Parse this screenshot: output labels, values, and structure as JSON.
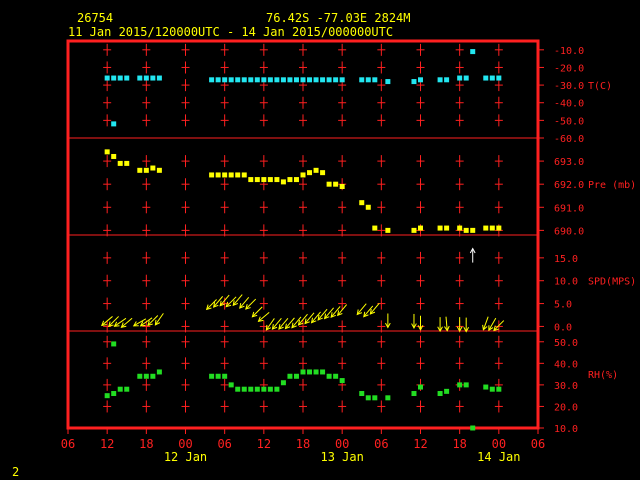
{
  "header": {
    "station_id": "26754",
    "location": "76.42S   -77.03E   2824M",
    "time_range": "11 Jan 2015/120000UTC - 14 Jan 2015/000000UTC"
  },
  "footer": {
    "page_number": "2"
  },
  "colors": {
    "frame": "#ff2020",
    "temperature": "#22e6f0",
    "pressure": "#ffff00",
    "wind": "#ffff00",
    "wind_outlier": "#ffffff",
    "humidity": "#22dd22",
    "header_text": "#ffff00"
  },
  "chart_data": [
    {
      "type": "scatter",
      "ylabel": "T(C)",
      "ylim": [
        -60,
        -5
      ],
      "yticks": [
        "-10.0",
        "-20.0",
        "-30.0",
        "-40.0",
        "-50.0",
        "-60.0"
      ],
      "ytick_values": [
        -10,
        -20,
        -30,
        -40,
        -50,
        -60
      ],
      "series": [
        {
          "x": [
            12,
            13,
            14,
            15,
            17,
            18,
            19,
            20,
            28,
            29,
            30,
            31,
            32,
            33,
            34,
            35,
            36,
            37,
            38,
            39,
            40,
            41,
            42,
            43,
            44,
            45,
            46,
            47,
            48,
            51,
            52,
            53,
            55,
            59,
            60,
            63,
            64,
            66,
            67,
            68,
            70,
            71,
            72
          ],
          "values": [
            -26,
            -26,
            -26,
            -26,
            -26,
            -26,
            -26,
            -26,
            -27,
            -27,
            -27,
            -27,
            -27,
            -27,
            -27,
            -27,
            -27,
            -27,
            -27,
            -27,
            -27,
            -27,
            -27,
            -27,
            -27,
            -27,
            -27,
            -27,
            -27,
            -27,
            -27,
            -27,
            -28,
            -28,
            -27,
            -27,
            -27,
            -26,
            -26,
            -11,
            -26,
            -26,
            -26
          ]
        },
        {
          "x": [
            13
          ],
          "values": [
            -52
          ]
        }
      ]
    },
    {
      "type": "scatter",
      "ylabel": "Pre (mb)",
      "ylim": [
        689.8,
        694.0
      ],
      "yticks": [
        "693.0",
        "692.0",
        "691.0",
        "690.0"
      ],
      "ytick_values": [
        693,
        692,
        691,
        690
      ],
      "series": [
        {
          "x": [
            12,
            13,
            14,
            15,
            17,
            18,
            19,
            20,
            28,
            29,
            30,
            31,
            32,
            33,
            34,
            35,
            36,
            37,
            38,
            39,
            40,
            41,
            42,
            43,
            44,
            45,
            46,
            47,
            48,
            51,
            52,
            53,
            55,
            59,
            60,
            63,
            64,
            66,
            67,
            68,
            70,
            71,
            72
          ],
          "values": [
            693.4,
            693.2,
            692.9,
            692.9,
            692.6,
            692.6,
            692.7,
            692.6,
            692.4,
            692.4,
            692.4,
            692.4,
            692.4,
            692.4,
            692.2,
            692.2,
            692.2,
            692.2,
            692.2,
            692.1,
            692.2,
            692.2,
            692.4,
            692.5,
            692.6,
            692.5,
            692.0,
            692.0,
            691.9,
            691.2,
            691.0,
            690.1,
            690.0,
            690.0,
            690.1,
            690.1,
            690.1,
            690.1,
            690.0,
            690.0,
            690.1,
            690.1,
            690.1
          ]
        }
      ]
    },
    {
      "type": "scatter",
      "ylabel": "SPD(MPS)",
      "ylim": [
        -1.0,
        20.0
      ],
      "yticks": [
        "15.0",
        "10.0",
        "5.0",
        "0.0"
      ],
      "ytick_values": [
        15,
        10,
        5,
        0
      ],
      "series": [
        {
          "name": "wind",
          "x": [
            12,
            13,
            14,
            15,
            17,
            18,
            19,
            20,
            28,
            29,
            30,
            31,
            32,
            33,
            34,
            35,
            36,
            37,
            38,
            39,
            40,
            41,
            42,
            43,
            44,
            45,
            46,
            47,
            48,
            51,
            52,
            53,
            55,
            59,
            60,
            63,
            64,
            66,
            67,
            68,
            70,
            71,
            72
          ],
          "values": [
            1.2,
            1.1,
            0.9,
            0.8,
            0.9,
            1.0,
            1.3,
            1.6,
            4.8,
            5.4,
            5.7,
            5.4,
            5.8,
            5.2,
            4.9,
            3.2,
            2.1,
            0.5,
            0.6,
            0.6,
            0.7,
            0.9,
            1.5,
            1.8,
            2.0,
            2.6,
            2.9,
            3.2,
            3.6,
            3.8,
            3.3,
            3.9,
            1.3,
            1.2,
            0.8,
            0.5,
            0.6,
            0.5,
            0.4,
            15.5,
            0.7,
            0.5,
            0.2
          ],
          "direction_deg": [
            220,
            225,
            215,
            220,
            210,
            215,
            225,
            235,
            225,
            230,
            230,
            225,
            230,
            230,
            225,
            225,
            220,
            235,
            230,
            230,
            230,
            230,
            230,
            230,
            230,
            230,
            230,
            230,
            230,
            230,
            230,
            230,
            270,
            270,
            270,
            270,
            275,
            270,
            270,
            90,
            250,
            240,
            225
          ]
        }
      ]
    },
    {
      "type": "scatter",
      "ylabel": "RH(%)",
      "ylim": [
        10,
        55
      ],
      "yticks": [
        "50.0",
        "40.0",
        "30.0",
        "20.0",
        "10.0"
      ],
      "ytick_values": [
        50,
        40,
        30,
        20,
        10
      ],
      "series": [
        {
          "x": [
            12,
            13,
            14,
            15,
            17,
            18,
            19,
            20,
            28,
            29,
            30,
            31,
            32,
            33,
            34,
            35,
            36,
            37,
            38,
            39,
            40,
            41,
            42,
            43,
            44,
            45,
            46,
            47,
            48,
            51,
            52,
            53,
            55,
            59,
            60,
            63,
            64,
            66,
            67,
            68,
            70,
            71,
            72
          ],
          "values": [
            25,
            26,
            28,
            28,
            34,
            34,
            34,
            36,
            34,
            34,
            34,
            30,
            28,
            28,
            28,
            28,
            28,
            28,
            28,
            31,
            34,
            34,
            36,
            36,
            36,
            36,
            34,
            34,
            32,
            26,
            24,
            24,
            24,
            26,
            29,
            26,
            27,
            30,
            30,
            10,
            29,
            28,
            28
          ]
        },
        {
          "x": [
            13
          ],
          "values": [
            49
          ]
        }
      ]
    }
  ],
  "x_axis": {
    "xlim": [
      6,
      78
    ],
    "tick_hours": [
      6,
      12,
      18,
      24,
      30,
      36,
      42,
      48,
      54,
      60,
      66,
      72,
      78
    ],
    "tick_labels": [
      "06",
      "12",
      "18",
      "00",
      "06",
      "12",
      "18",
      "00",
      "06",
      "12",
      "18",
      "00",
      "06"
    ],
    "date_labels": [
      {
        "hour": 24,
        "text": "12 Jan"
      },
      {
        "hour": 48,
        "text": "13 Jan"
      },
      {
        "hour": 72,
        "text": "14 Jan"
      }
    ]
  }
}
